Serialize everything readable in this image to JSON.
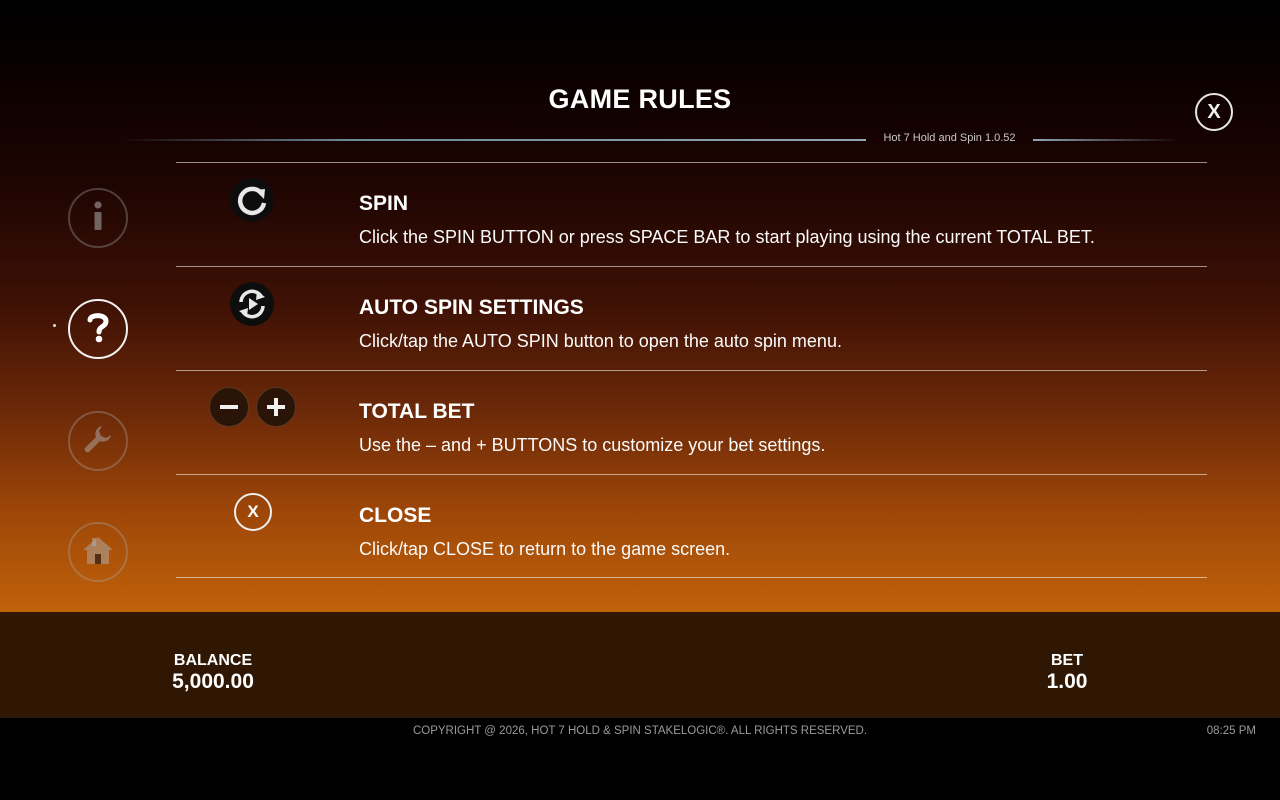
{
  "header": {
    "title": "GAME RULES",
    "version": "Hot 7 Hold and Spin 1.0.52",
    "close_label": "X"
  },
  "side_nav": [
    {
      "icon": "info-icon",
      "active": false
    },
    {
      "icon": "help-icon",
      "active": true
    },
    {
      "icon": "settings-wrench-icon",
      "active": false
    },
    {
      "icon": "home-icon",
      "active": false
    }
  ],
  "rules": [
    {
      "icon": "spin-icon",
      "title": "SPIN",
      "description": "Click the SPIN BUTTON or press SPACE BAR to start playing using the current TOTAL BET."
    },
    {
      "icon": "auto-spin-icon",
      "title": "AUTO SPIN SETTINGS",
      "description": "Click/tap the AUTO SPIN button to open the auto spin menu."
    },
    {
      "icon": "minus-plus-icons",
      "title": "TOTAL BET",
      "description": "Use the – and + BUTTONS to customize your bet settings."
    },
    {
      "icon": "close-icon",
      "icon_text": "X",
      "title": "CLOSE",
      "description": "Click/tap CLOSE to return to the game screen."
    }
  ],
  "bottom": {
    "balance_label": "BALANCE",
    "balance_value": "5,000.00",
    "bet_label": "BET",
    "bet_value": "1.00"
  },
  "footer": {
    "copyright": "COPYRIGHT @ 2026, HOT 7 HOLD & SPIN STAKELOGIC®. ALL RIGHTS RESERVED.",
    "time": "08:25 PM"
  },
  "colors": {
    "background_bottom": "#c0620a",
    "bottom_bar": "#2f1703",
    "footer": "#000000"
  }
}
